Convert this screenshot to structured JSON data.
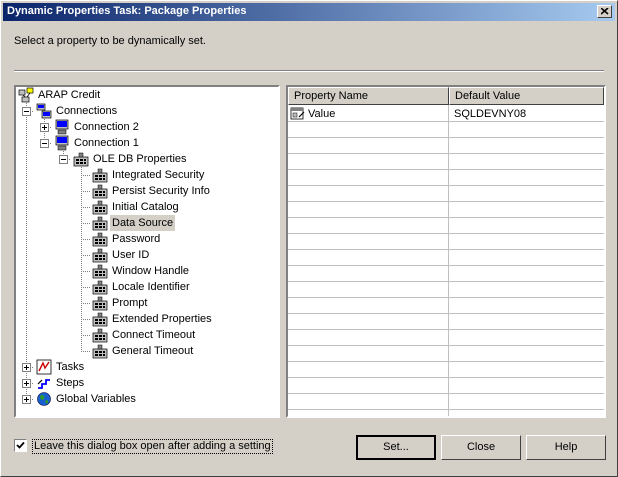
{
  "window": {
    "title": "Dynamic Properties Task: Package Properties"
  },
  "instruction": "Select a property to be dynamically set.",
  "tree": {
    "root": "ARAP Credit",
    "connections": "Connections",
    "connection2": "Connection 2",
    "connection1": "Connection 1",
    "oledb": "OLE DB Properties",
    "properties": [
      "Integrated Security",
      "Persist Security Info",
      "Initial Catalog",
      "Data Source",
      "Password",
      "User ID",
      "Window Handle",
      "Locale Identifier",
      "Prompt",
      "Extended Properties",
      "Connect Timeout",
      "General Timeout"
    ],
    "selected": "Data Source",
    "tasks": "Tasks",
    "steps": "Steps",
    "globals": "Global Variables"
  },
  "grid": {
    "columns": [
      "Property Name",
      "Default Value"
    ],
    "rows": [
      {
        "name": "Value",
        "value": "SQLDEVNY08"
      }
    ]
  },
  "checkbox": {
    "label": "Leave this dialog box open after adding a setting",
    "checked": true
  },
  "buttons": {
    "set": "Set...",
    "close": "Close",
    "help": "Help"
  },
  "icons": {
    "root": "package-icon",
    "connections": "connections-icon",
    "connection": "connection-icon",
    "property": "property-icon",
    "tasks": "tasks-icon",
    "steps": "steps-icon",
    "globals": "globe-icon"
  }
}
